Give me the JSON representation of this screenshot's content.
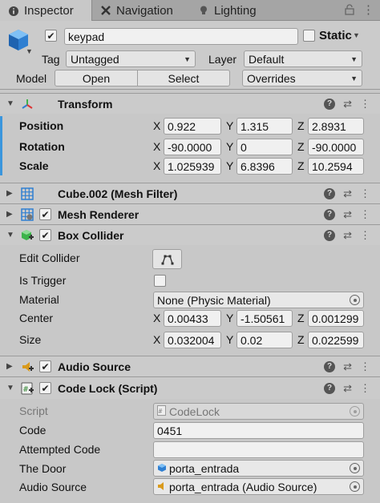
{
  "tabs": [
    {
      "label": "Inspector",
      "icon": "info-icon"
    },
    {
      "label": "Navigation",
      "icon": "navigation-icon"
    },
    {
      "label": "Lighting",
      "icon": "lightbulb-icon"
    }
  ],
  "object": {
    "name": "keypad",
    "static_label": "Static",
    "tag_label": "Tag",
    "tag_value": "Untagged",
    "layer_label": "Layer",
    "layer_value": "Default",
    "model_label": "Model",
    "open_label": "Open",
    "select_label": "Select",
    "overrides_label": "Overrides"
  },
  "transform": {
    "title": "Transform",
    "position_label": "Position",
    "rotation_label": "Rotation",
    "scale_label": "Scale",
    "position": {
      "x": "0.922",
      "y": "1.315",
      "z": "2.8931"
    },
    "rotation": {
      "x": "-90.0000",
      "y": "0",
      "z": "-90.0000"
    },
    "scale": {
      "x": "1.025939",
      "y": "6.8396",
      "z": "10.2594"
    }
  },
  "mesh_filter": {
    "title": "Cube.002 (Mesh Filter)"
  },
  "mesh_renderer": {
    "title": "Mesh Renderer"
  },
  "box_collider": {
    "title": "Box Collider",
    "edit_collider_label": "Edit Collider",
    "is_trigger_label": "Is Trigger",
    "material_label": "Material",
    "material_value": "None (Physic Material)",
    "center_label": "Center",
    "size_label": "Size",
    "center": {
      "x": "0.00433",
      "y": "-1.50561",
      "z": "0.001299"
    },
    "size": {
      "x": "0.032004",
      "y": "0.02",
      "z": "0.022599"
    }
  },
  "audio_source": {
    "title": "Audio Source"
  },
  "code_lock": {
    "title": "Code Lock (Script)",
    "script_label": "Script",
    "script_value": "CodeLock",
    "code_label": "Code",
    "code_value": "0451",
    "attempted_label": "Attempted Code",
    "attempted_value": "",
    "door_label": "The Door",
    "door_value": "porta_entrada",
    "audio_label": "Audio Source",
    "audio_value": "porta_entrada (Audio Source)"
  },
  "axes": {
    "x": "X",
    "y": "Y",
    "z": "Z"
  },
  "colors": {
    "accent": "#3a96dd",
    "panel": "#c8c8c8"
  }
}
